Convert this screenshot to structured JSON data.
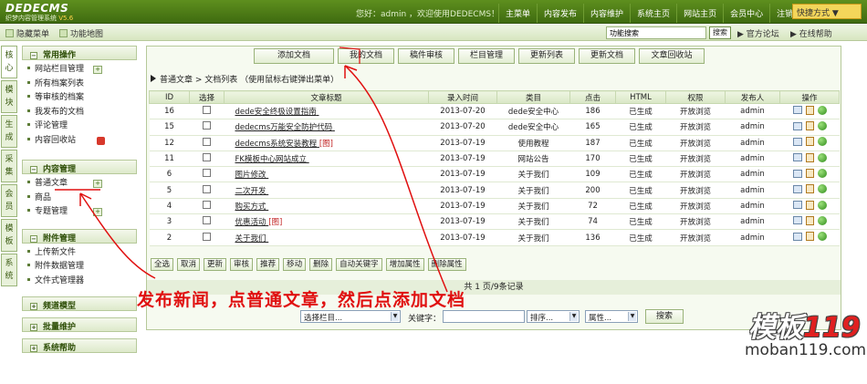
{
  "header": {
    "brand": "DEDECMS",
    "subtitle": "织梦内容管理系统",
    "version": "V5.6",
    "welcome": "您好：admin ，欢迎使用DEDECMS！",
    "nav": [
      "主菜单",
      "内容发布",
      "内容维护",
      "系统主页",
      "网站主页",
      "会员中心",
      "注销"
    ],
    "quick": "快捷方式"
  },
  "toolbar2": {
    "hide_menu": "隐藏菜单",
    "map": "功能地图",
    "search_placeholder": "功能搜索",
    "search_btn": "搜索",
    "forum": "官方论坛",
    "help": "在线帮助"
  },
  "vtabs": [
    "核心",
    "模块",
    "生成",
    "采集",
    "会员",
    "模板",
    "系统"
  ],
  "sidebar": {
    "group1": "常用操作",
    "group1_items": [
      "网站栏目管理",
      "所有档案列表",
      "等审核的档案",
      "我发布的文档",
      "评论管理",
      "内容回收站"
    ],
    "group2": "内容管理",
    "group2_items": [
      "普通文章",
      "商品",
      "专题管理"
    ],
    "group3": "附件管理",
    "group3_items": [
      "上传新文件",
      "附件数据管理",
      "文件式管理器"
    ],
    "group4": "频道模型",
    "group5": "批量维护",
    "group6": "系统帮助"
  },
  "buttons": [
    "添加文档",
    "我的文档",
    "稿件审核",
    "栏目管理",
    "更新列表",
    "更新文档",
    "文章回收站"
  ],
  "location": "普通文章 > 文档列表 （使用鼠标右键弹出菜单）",
  "table": {
    "headers": [
      "ID",
      "选择",
      "文章标题",
      "录入时间",
      "类目",
      "点击",
      "HTML",
      "权限",
      "发布人",
      "操作"
    ],
    "rows": [
      {
        "id": "16",
        "title": "dede安全终极设置指南",
        "tag": "",
        "time": "2013-07-20",
        "cat": "dede安全中心",
        "hits": "186",
        "html": "已生成",
        "perm": "开放浏览",
        "user": "admin"
      },
      {
        "id": "15",
        "title": "dedecms万能安全防护代码",
        "tag": "",
        "time": "2013-07-20",
        "cat": "dede安全中心",
        "hits": "165",
        "html": "已生成",
        "perm": "开放浏览",
        "user": "admin"
      },
      {
        "id": "12",
        "title": "dedecms系统安装教程",
        "tag": "[图]",
        "time": "2013-07-19",
        "cat": "使用教程",
        "hits": "187",
        "html": "已生成",
        "perm": "开放浏览",
        "user": "admin"
      },
      {
        "id": "11",
        "title": "FK模板中心网站成立",
        "tag": "",
        "time": "2013-07-19",
        "cat": "网站公告",
        "hits": "170",
        "html": "已生成",
        "perm": "开放浏览",
        "user": "admin"
      },
      {
        "id": "6",
        "title": "图片修改",
        "tag": "",
        "time": "2013-07-19",
        "cat": "关于我们",
        "hits": "109",
        "html": "已生成",
        "perm": "开放浏览",
        "user": "admin"
      },
      {
        "id": "5",
        "title": "二次开发",
        "tag": "",
        "time": "2013-07-19",
        "cat": "关于我们",
        "hits": "200",
        "html": "已生成",
        "perm": "开放浏览",
        "user": "admin"
      },
      {
        "id": "4",
        "title": "购买方式",
        "tag": "",
        "time": "2013-07-19",
        "cat": "关于我们",
        "hits": "72",
        "html": "已生成",
        "perm": "开放浏览",
        "user": "admin"
      },
      {
        "id": "3",
        "title": "优惠活动",
        "tag": "[图]",
        "time": "2013-07-19",
        "cat": "关于我们",
        "hits": "74",
        "html": "已生成",
        "perm": "开放浏览",
        "user": "admin"
      },
      {
        "id": "2",
        "title": "关于我们",
        "tag": "",
        "time": "2013-07-19",
        "cat": "关于我们",
        "hits": "136",
        "html": "已生成",
        "perm": "开放浏览",
        "user": "admin"
      }
    ]
  },
  "actions": [
    "全选",
    "取消",
    "更新",
    "审核",
    "推荐",
    "移动",
    "删除",
    "自动关键字",
    "增加属性",
    "删除属性"
  ],
  "pager": "共 1 页/9条记录",
  "filter": {
    "column": "选择栏目...",
    "keyword_label": "关键字：",
    "sort": "排序...",
    "attr": "属性...",
    "search": "搜索"
  },
  "annotation": "发布新闻，点普通文章，然后点添加文档",
  "watermark": {
    "text": "模板",
    "num": "119",
    "url": "moban119.com"
  }
}
